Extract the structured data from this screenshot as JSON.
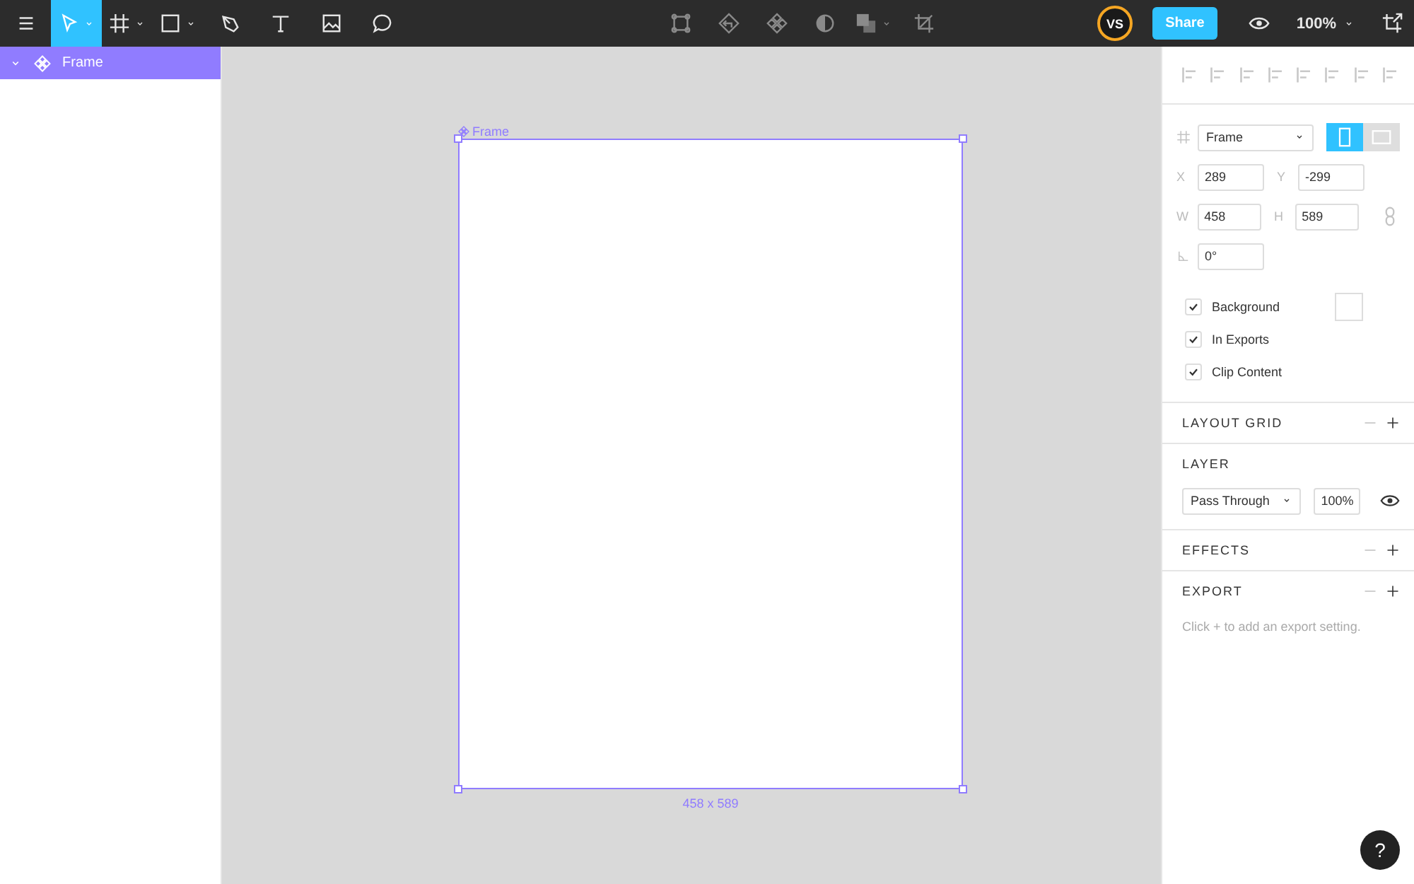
{
  "toolbar": {
    "tools": [
      {
        "kind": "move",
        "selected": true,
        "dropdown": true
      },
      {
        "kind": "frame",
        "selected": false,
        "dropdown": true
      },
      {
        "kind": "rectangle",
        "selected": false,
        "dropdown": true
      },
      {
        "kind": "pen",
        "selected": false,
        "dropdown": false
      },
      {
        "kind": "text",
        "selected": false,
        "dropdown": false
      },
      {
        "kind": "image",
        "selected": false,
        "dropdown": false
      },
      {
        "kind": "comment",
        "selected": false,
        "dropdown": false
      }
    ],
    "center_tools": [
      {
        "kind": "frame-selection",
        "dropdown": false
      },
      {
        "kind": "component-swap",
        "dropdown": false
      },
      {
        "kind": "component",
        "dropdown": false
      },
      {
        "kind": "mask",
        "dropdown": false
      },
      {
        "kind": "boolean",
        "dropdown": true
      },
      {
        "kind": "crop",
        "dropdown": false
      }
    ],
    "avatar": "VS",
    "share": "Share",
    "zoom": "100%"
  },
  "layers": [
    {
      "name": "Frame",
      "selected": true,
      "expanded": true
    }
  ],
  "canvas": {
    "frame_label": "Frame",
    "size_label": "458 x 589"
  },
  "properties": {
    "preset": "Frame",
    "orientations": [
      {
        "kind": "portrait",
        "selected": true
      },
      {
        "kind": "landscape",
        "selected": false
      }
    ],
    "fields": [
      [
        {
          "label": "X",
          "value": "289"
        },
        {
          "label": "Y",
          "value": "-299"
        }
      ],
      [
        {
          "label": "W",
          "value": "458"
        },
        {
          "label": "H",
          "value": "589"
        }
      ]
    ],
    "rotation": "0°",
    "options": [
      {
        "label": "Background",
        "checked": true,
        "swatch": true
      },
      {
        "label": "In Exports",
        "checked": true
      },
      {
        "label": "Clip Content",
        "checked": true
      }
    ],
    "layout_grid": "LAYOUT GRID",
    "layer": {
      "title": "LAYER",
      "blend": "Pass Through",
      "opacity": "100%"
    },
    "effects": "EFFECTS",
    "export": {
      "title": "EXPORT",
      "hint": "Click + to add an export setting."
    }
  },
  "help": "?"
}
